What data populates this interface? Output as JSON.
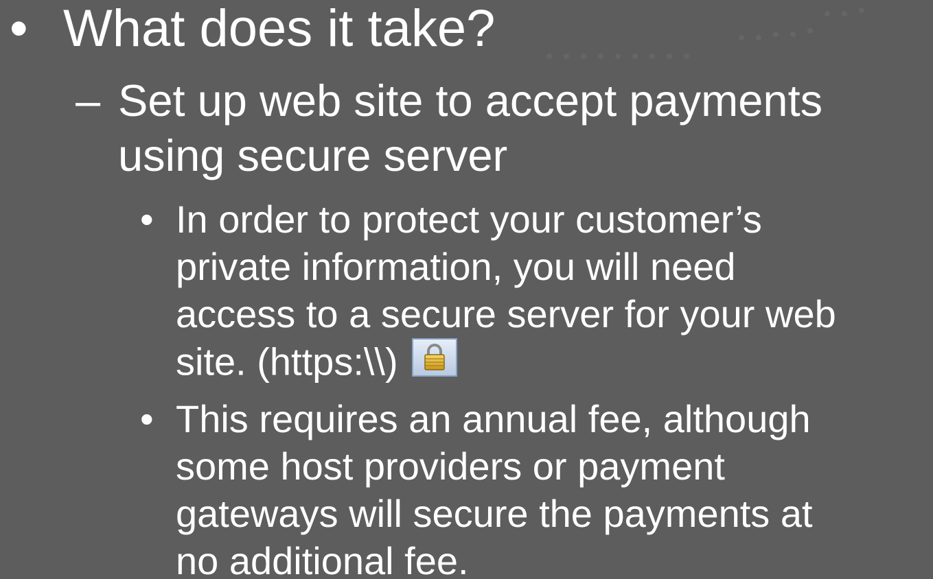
{
  "slide": {
    "heading": {
      "bullet": "•",
      "text": "What does it take?"
    },
    "subpoint": {
      "marker": "–",
      "lines": [
        "Set up web site to accept payments",
        "using secure server"
      ]
    },
    "details": [
      {
        "bullet": "•",
        "lines": [
          "In order to protect your customer’s",
          "private information, you will need",
          "access to a secure server for your web",
          "site.  (https:\\\\)"
        ],
        "icon": "lock-icon"
      },
      {
        "bullet": "•",
        "lines": [
          "This requires an annual fee, although",
          "some host providers or payment",
          "gateways will secure the payments at",
          "no additional fee."
        ]
      }
    ]
  },
  "colors": {
    "background": "#5d5d5d",
    "text": "#ffffff",
    "lock_gold": "#e8b830"
  }
}
